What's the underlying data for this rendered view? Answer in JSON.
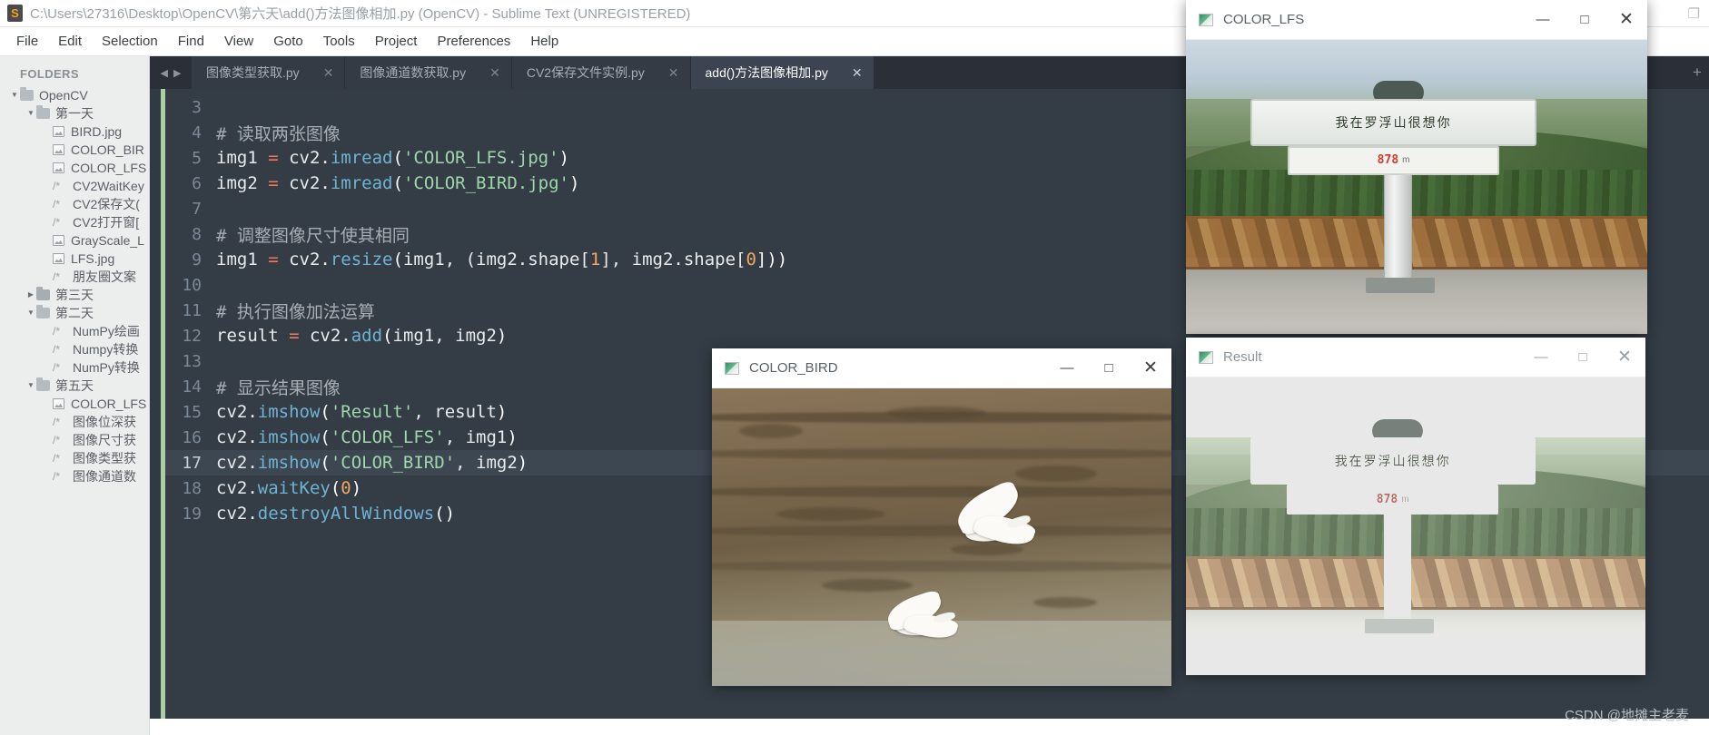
{
  "window": {
    "title": "C:\\Users\\27316\\Desktop\\OpenCV\\第六天\\add()方法图像相加.py (OpenCV) - Sublime Text (UNREGISTERED)",
    "logo_glyph": "S",
    "minimize": "—",
    "maximize": "□",
    "close": "✕",
    "restore_icon": "❐"
  },
  "menu": {
    "items": [
      "File",
      "Edit",
      "Selection",
      "Find",
      "View",
      "Goto",
      "Tools",
      "Project",
      "Preferences",
      "Help"
    ]
  },
  "sidebar": {
    "header": "FOLDERS",
    "tree": [
      {
        "label": "OpenCV",
        "level": 1,
        "type": "folder",
        "state": "open"
      },
      {
        "label": "第一天",
        "level": 2,
        "type": "folder",
        "state": "open"
      },
      {
        "label": "BIRD.jpg",
        "level": 3,
        "type": "image"
      },
      {
        "label": "COLOR_BIR",
        "level": 3,
        "type": "image"
      },
      {
        "label": "COLOR_LFS",
        "level": 3,
        "type": "image"
      },
      {
        "label": "CV2WaitKey",
        "level": 3,
        "type": "code"
      },
      {
        "label": "CV2保存文(",
        "level": 3,
        "type": "code"
      },
      {
        "label": "CV2打开窗[",
        "level": 3,
        "type": "code"
      },
      {
        "label": "GrayScale_L",
        "level": 3,
        "type": "image"
      },
      {
        "label": "LFS.jpg",
        "level": 3,
        "type": "image"
      },
      {
        "label": "朋友圈文案",
        "level": 3,
        "type": "code"
      },
      {
        "label": "第三天",
        "level": 2,
        "type": "folder",
        "state": "closed"
      },
      {
        "label": "第二天",
        "level": 2,
        "type": "folder",
        "state": "open"
      },
      {
        "label": "NumPy绘画",
        "level": 3,
        "type": "code"
      },
      {
        "label": "Numpy转换",
        "level": 3,
        "type": "code"
      },
      {
        "label": "NumPy转换",
        "level": 3,
        "type": "code"
      },
      {
        "label": "第五天",
        "level": 2,
        "type": "folder",
        "state": "open"
      },
      {
        "label": "COLOR_LFS",
        "level": 3,
        "type": "image"
      },
      {
        "label": "图像位深获",
        "level": 3,
        "type": "code"
      },
      {
        "label": "图像尺寸获",
        "level": 3,
        "type": "code"
      },
      {
        "label": "图像类型获",
        "level": 3,
        "type": "code"
      },
      {
        "label": "图像通道数",
        "level": 3,
        "type": "code"
      }
    ],
    "expand_glyph": "▼",
    "collapse_glyph": "▶",
    "code_glyph": "/*"
  },
  "tabs": {
    "prev_glyph": "◀",
    "next_glyph": "▶",
    "close_glyph": "✕",
    "new_tab_glyph": "+",
    "items": [
      {
        "label": "图像类型获取.py",
        "active": false
      },
      {
        "label": "图像通道数获取.py",
        "active": false
      },
      {
        "label": "CV2保存文件实例.py",
        "active": false
      },
      {
        "label": "add()方法图像相加.py",
        "active": true
      }
    ]
  },
  "editor": {
    "current_line": 17,
    "lines": [
      {
        "no": "3",
        "tokens": []
      },
      {
        "no": "4",
        "tokens": [
          {
            "t": "# 读取两张图像",
            "c": "tk-cm"
          }
        ]
      },
      {
        "no": "5",
        "tokens": [
          {
            "t": "img1 ",
            "c": "tk-id"
          },
          {
            "t": "=",
            "c": "tk-op"
          },
          {
            "t": " cv2.",
            "c": "tk-id"
          },
          {
            "t": "imread",
            "c": "tk-fn"
          },
          {
            "t": "(",
            "c": "tk-pn"
          },
          {
            "t": "'COLOR_LFS.jpg'",
            "c": "tk-str"
          },
          {
            "t": ")",
            "c": "tk-pn"
          }
        ]
      },
      {
        "no": "6",
        "tokens": [
          {
            "t": "img2 ",
            "c": "tk-id"
          },
          {
            "t": "=",
            "c": "tk-op"
          },
          {
            "t": " cv2.",
            "c": "tk-id"
          },
          {
            "t": "imread",
            "c": "tk-fn"
          },
          {
            "t": "(",
            "c": "tk-pn"
          },
          {
            "t": "'COLOR_BIRD.jpg'",
            "c": "tk-str"
          },
          {
            "t": ")",
            "c": "tk-pn"
          }
        ]
      },
      {
        "no": "7",
        "tokens": []
      },
      {
        "no": "8",
        "tokens": [
          {
            "t": "# 调整图像尺寸使其相同",
            "c": "tk-cm"
          }
        ]
      },
      {
        "no": "9",
        "tokens": [
          {
            "t": "img1 ",
            "c": "tk-id"
          },
          {
            "t": "=",
            "c": "tk-op"
          },
          {
            "t": " cv2.",
            "c": "tk-id"
          },
          {
            "t": "resize",
            "c": "tk-fn"
          },
          {
            "t": "(",
            "c": "tk-pn"
          },
          {
            "t": "img1, (img2.shape[",
            "c": "tk-id"
          },
          {
            "t": "1",
            "c": "tk-num"
          },
          {
            "t": "], img2.shape[",
            "c": "tk-id"
          },
          {
            "t": "0",
            "c": "tk-num"
          },
          {
            "t": "]))",
            "c": "tk-pn"
          }
        ]
      },
      {
        "no": "10",
        "tokens": []
      },
      {
        "no": "11",
        "tokens": [
          {
            "t": "# 执行图像加法运算",
            "c": "tk-cm"
          }
        ]
      },
      {
        "no": "12",
        "tokens": [
          {
            "t": "result ",
            "c": "tk-id"
          },
          {
            "t": "=",
            "c": "tk-op"
          },
          {
            "t": " cv2.",
            "c": "tk-id"
          },
          {
            "t": "add",
            "c": "tk-fn"
          },
          {
            "t": "(",
            "c": "tk-pn"
          },
          {
            "t": "img1, img2",
            "c": "tk-id"
          },
          {
            "t": ")",
            "c": "tk-pn"
          }
        ]
      },
      {
        "no": "13",
        "tokens": []
      },
      {
        "no": "14",
        "tokens": [
          {
            "t": "# 显示结果图像",
            "c": "tk-cm"
          }
        ]
      },
      {
        "no": "15",
        "tokens": [
          {
            "t": "cv2.",
            "c": "tk-id"
          },
          {
            "t": "imshow",
            "c": "tk-fn"
          },
          {
            "t": "(",
            "c": "tk-pn"
          },
          {
            "t": "'Result'",
            "c": "tk-str"
          },
          {
            "t": ", result",
            "c": "tk-id"
          },
          {
            "t": ")",
            "c": "tk-pn"
          }
        ]
      },
      {
        "no": "16",
        "tokens": [
          {
            "t": "cv2.",
            "c": "tk-id"
          },
          {
            "t": "imshow",
            "c": "tk-fn"
          },
          {
            "t": "(",
            "c": "tk-pn"
          },
          {
            "t": "'COLOR_LFS'",
            "c": "tk-str"
          },
          {
            "t": ", img1",
            "c": "tk-id"
          },
          {
            "t": ")",
            "c": "tk-pn"
          }
        ]
      },
      {
        "no": "17",
        "tokens": [
          {
            "t": "cv2.",
            "c": "tk-id"
          },
          {
            "t": "imshow",
            "c": "tk-fn"
          },
          {
            "t": "(",
            "c": "tk-pn"
          },
          {
            "t": "'COLOR_BIRD'",
            "c": "tk-str"
          },
          {
            "t": ", img2",
            "c": "tk-id"
          },
          {
            "t": ")",
            "c": "tk-pn"
          }
        ]
      },
      {
        "no": "18",
        "tokens": [
          {
            "t": "cv2.",
            "c": "tk-id"
          },
          {
            "t": "waitKey",
            "c": "tk-fn"
          },
          {
            "t": "(",
            "c": "tk-pn"
          },
          {
            "t": "0",
            "c": "tk-num"
          },
          {
            "t": ")",
            "c": "tk-pn"
          }
        ]
      },
      {
        "no": "19",
        "tokens": [
          {
            "t": "cv2.",
            "c": "tk-id"
          },
          {
            "t": "destroyAllWindows",
            "c": "tk-fn"
          },
          {
            "t": "()",
            "c": "tk-pn"
          }
        ]
      }
    ]
  },
  "cv_windows": {
    "minimize_glyph": "—",
    "maximize_glyph": "□",
    "close_glyph": "✕",
    "color_lfs": {
      "title": "COLOR_LFS",
      "sign_text": "我在罗浮山很想你",
      "altitude": "878",
      "altitude_unit": "m"
    },
    "color_bird": {
      "title": "COLOR_BIRD"
    },
    "result": {
      "title": "Result",
      "sign_text": "我在罗浮山很想你",
      "altitude": "878",
      "altitude_unit": "m"
    }
  },
  "watermark": {
    "text": "CSDN @地摊主老麦"
  },
  "colors": {
    "editor_bg": "#343d46",
    "tab_active_bg": "#3b4450",
    "sidebar_bg": "#eceded",
    "accent_orange": "#f79e1b",
    "string_green": "#9fd6ab",
    "function_blue": "#6fb3d2"
  }
}
